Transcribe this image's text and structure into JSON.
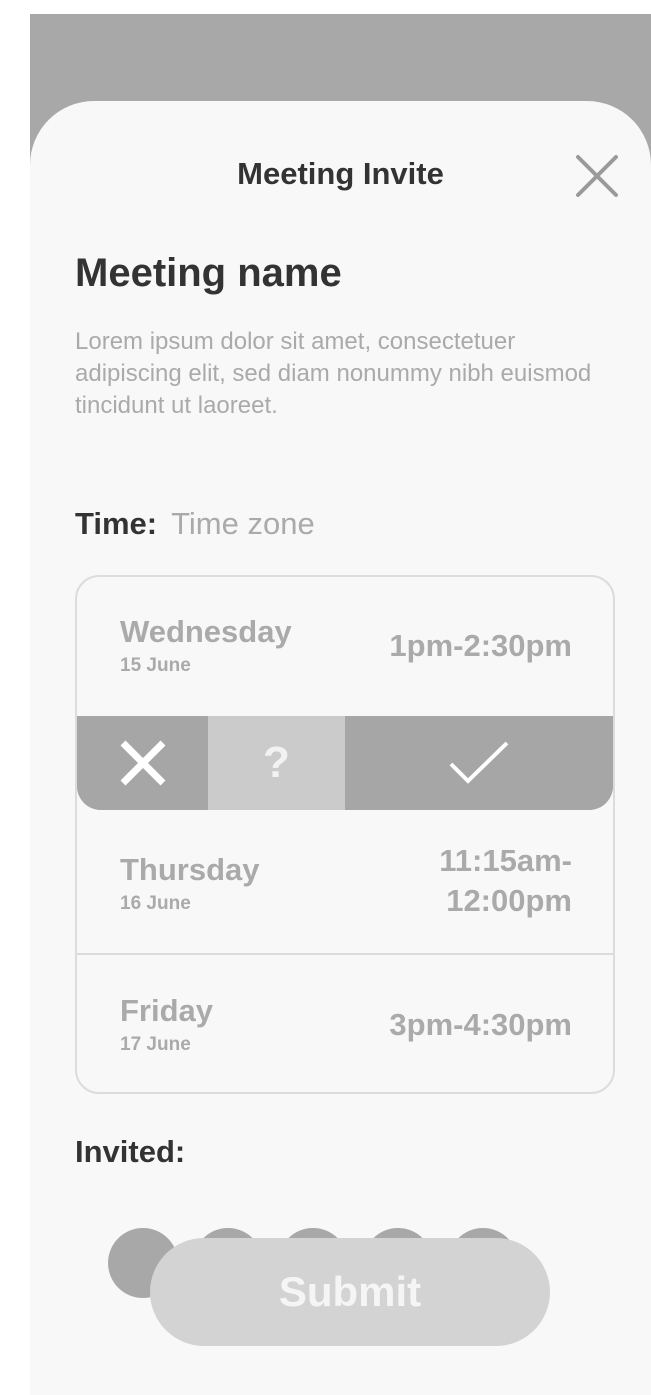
{
  "header": {
    "title": "Meeting Invite",
    "close_icon": "close-icon"
  },
  "meeting": {
    "name": "Meeting name",
    "description": "Lorem ipsum dolor sit amet, consectetuer adipiscing elit, sed diam nonummy nibh euismod tincidunt ut laoreet."
  },
  "time": {
    "label": "Time:",
    "timezone": "Time zone"
  },
  "slots": [
    {
      "day": "Wednesday",
      "date": "15 June",
      "time": "1pm-2:30pm"
    },
    {
      "day": "Thursday",
      "date": "16 June",
      "time_line1": "11:15am-",
      "time_line2": "12:00pm"
    },
    {
      "day": "Friday",
      "date": "17 June",
      "time": "3pm-4:30pm"
    }
  ],
  "actions": {
    "decline_icon": "x-icon",
    "maybe_label": "?",
    "accept_icon": "check-icon"
  },
  "invited": {
    "label": "Invited:",
    "avatar_count": 5
  },
  "submit": {
    "label": "Submit"
  },
  "colors": {
    "overlay": "#a8a8a8",
    "sheet": "#f8f8f8",
    "muted_text": "#aaaaaa",
    "dark_text": "#333333",
    "action_bar": "#a6a6a6",
    "maybe": "#cbcbcb"
  }
}
